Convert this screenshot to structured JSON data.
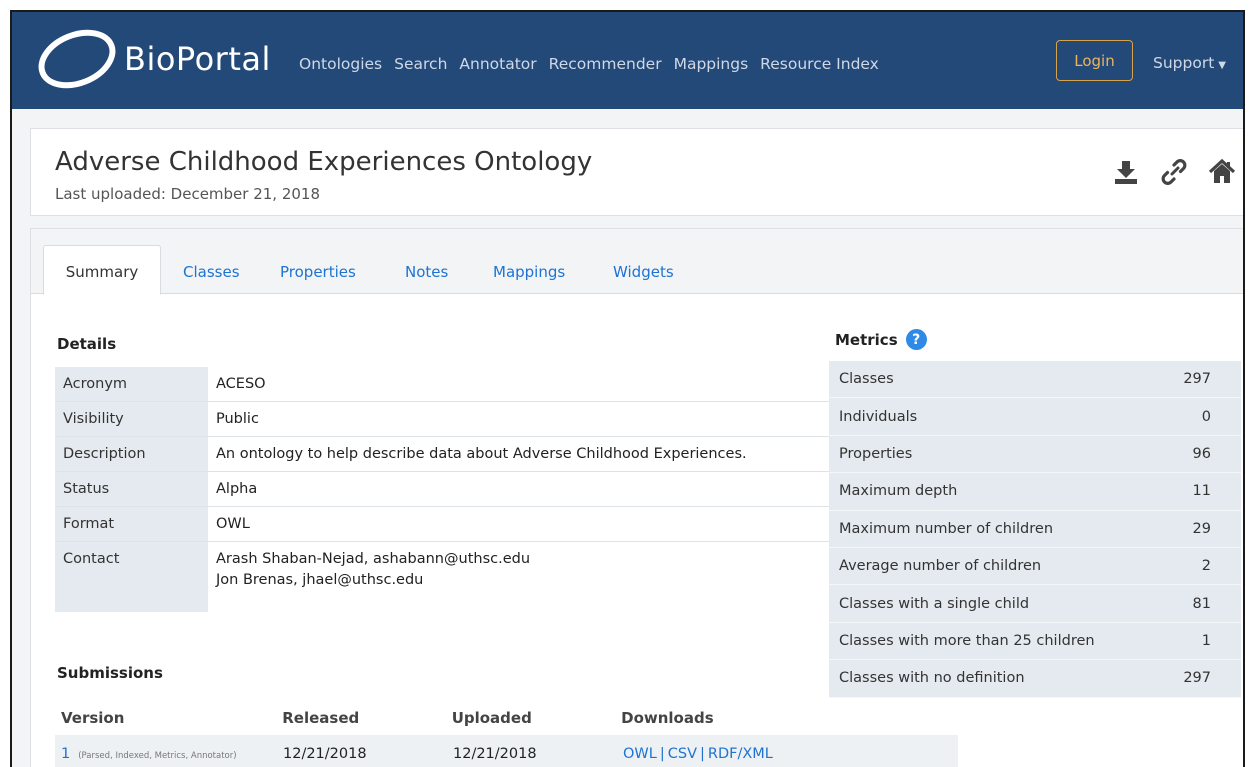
{
  "navbar": {
    "brand": "BioPortal",
    "links": [
      "Ontologies",
      "Search",
      "Annotator",
      "Recommender",
      "Mappings",
      "Resource Index"
    ],
    "login": "Login",
    "support": "Support"
  },
  "ontology": {
    "title": "Adverse Childhood Experiences Ontology",
    "uploaded": "Last uploaded: December 21, 2018"
  },
  "tabs": [
    "Summary",
    "Classes",
    "Properties",
    "Notes",
    "Mappings",
    "Widgets"
  ],
  "details": {
    "heading": "Details",
    "rows": [
      {
        "key": "Acronym",
        "value": "ACESO"
      },
      {
        "key": "Visibility",
        "value": "Public"
      },
      {
        "key": "Description",
        "value": "An ontology to help describe data about Adverse Childhood Experiences."
      },
      {
        "key": "Status",
        "value": "Alpha"
      },
      {
        "key": "Format",
        "value": "OWL"
      },
      {
        "key": "Contact",
        "value": "Arash Shaban-Nejad,  ashabann@uthsc.edu",
        "value2": "Jon Brenas, jhael@uthsc.edu"
      }
    ]
  },
  "metrics": {
    "heading": "Metrics",
    "rows": [
      {
        "label": "Classes",
        "value": "297"
      },
      {
        "label": "Individuals",
        "value": "0"
      },
      {
        "label": "Properties",
        "value": "96"
      },
      {
        "label": "Maximum depth",
        "value": "11"
      },
      {
        "label": "Maximum number of children",
        "value": "29"
      },
      {
        "label": "Average number of children",
        "value": "2"
      },
      {
        "label": "Classes with a single child",
        "value": "81"
      },
      {
        "label": "Classes with more than 25 children",
        "value": "1"
      },
      {
        "label": "Classes with no definition",
        "value": "297"
      }
    ]
  },
  "submissions": {
    "heading": "Submissions",
    "columns": [
      "Version",
      "Released",
      "Uploaded",
      "Downloads"
    ],
    "rows": [
      {
        "version": "1",
        "status": "(Parsed, Indexed, Metrics, Annotator)",
        "released": "12/21/2018",
        "uploaded": "12/21/2018",
        "downloads": [
          "OWL",
          "CSV",
          "RDF/XML"
        ]
      }
    ]
  },
  "icons": [
    "download-icon",
    "link-icon",
    "home-icon",
    "help-icon"
  ],
  "colors": {
    "navbar": "#234979",
    "link": "#1e73d2",
    "login_border": "#d8a24a"
  }
}
